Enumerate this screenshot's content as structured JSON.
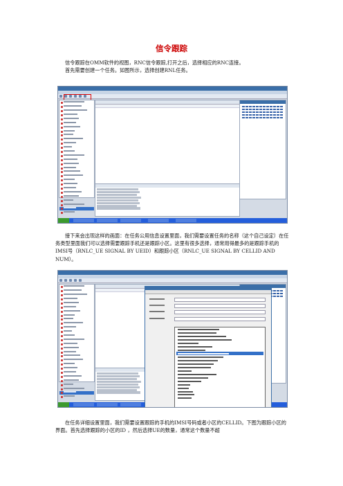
{
  "title": "信令跟踪",
  "intro": {
    "line1": "信令跟踪在OMM软件的视图，RNC信令跟踪,打开之后，选择相应的RNC连接。",
    "line2": "首先需要创建一个任务。如图所示，选择创建RNL任务。"
  },
  "para2": "接下来会出现这样的画面：在任务公用信息设置里面，我们需要设置任务的名称（这个自己设定）在任务类型里面我们可以选择需要跟踪手机还是跟踪小区。这里有很多选择，通常用得最多的是跟踪手机的IMSI号（RNLC_UE SIGNAL BY UEID）和跟踪小区（RNLC_UE SIGNAL BY CELLID AND NUM）。",
  "para3": "在任务详细设置里面，我们需要设置跟踪的手机的IMSI号码或者小区的CELLID。下图为跟踪小区的界面。首先选择跟踪的小区的ID ，然后选择UE的数量，通常这个数量不超",
  "colors": {
    "title": "#cc0000",
    "highlight": "#e00000",
    "window_accent": "#3a6ea8",
    "taskbar": "#245edb"
  }
}
